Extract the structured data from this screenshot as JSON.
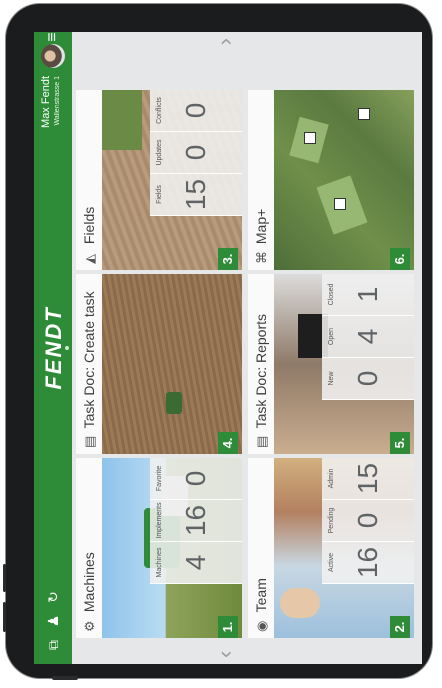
{
  "brand": "FENDT",
  "user": {
    "name": "Max Fendt",
    "role": "Wallenstrasse 1"
  },
  "tiles": [
    {
      "num": "1.",
      "title": "Machines",
      "stats": [
        {
          "label": "Machines",
          "value": "4"
        },
        {
          "label": "Implements",
          "value": "16"
        },
        {
          "label": "Favorite",
          "value": "0"
        }
      ]
    },
    {
      "num": "4.",
      "title": "Task Doc: Create task"
    },
    {
      "num": "3.",
      "title": "Fields",
      "stats": [
        {
          "label": "Fields",
          "value": "15"
        },
        {
          "label": "Updates",
          "value": "0"
        },
        {
          "label": "Conflicts",
          "value": "0"
        }
      ]
    },
    {
      "num": "2.",
      "title": "Team",
      "stats": [
        {
          "label": "Active",
          "value": "16"
        },
        {
          "label": "Pending",
          "value": "0"
        },
        {
          "label": "Admin",
          "value": "15"
        }
      ]
    },
    {
      "num": "5.",
      "title": "Task Doc: Reports",
      "stats": [
        {
          "label": "New",
          "value": "0"
        },
        {
          "label": "Open",
          "value": "4"
        },
        {
          "label": "Closed",
          "value": "1"
        }
      ]
    },
    {
      "num": "6.",
      "title": "Map+"
    }
  ],
  "colors": {
    "brand_green": "#2e8b37"
  }
}
